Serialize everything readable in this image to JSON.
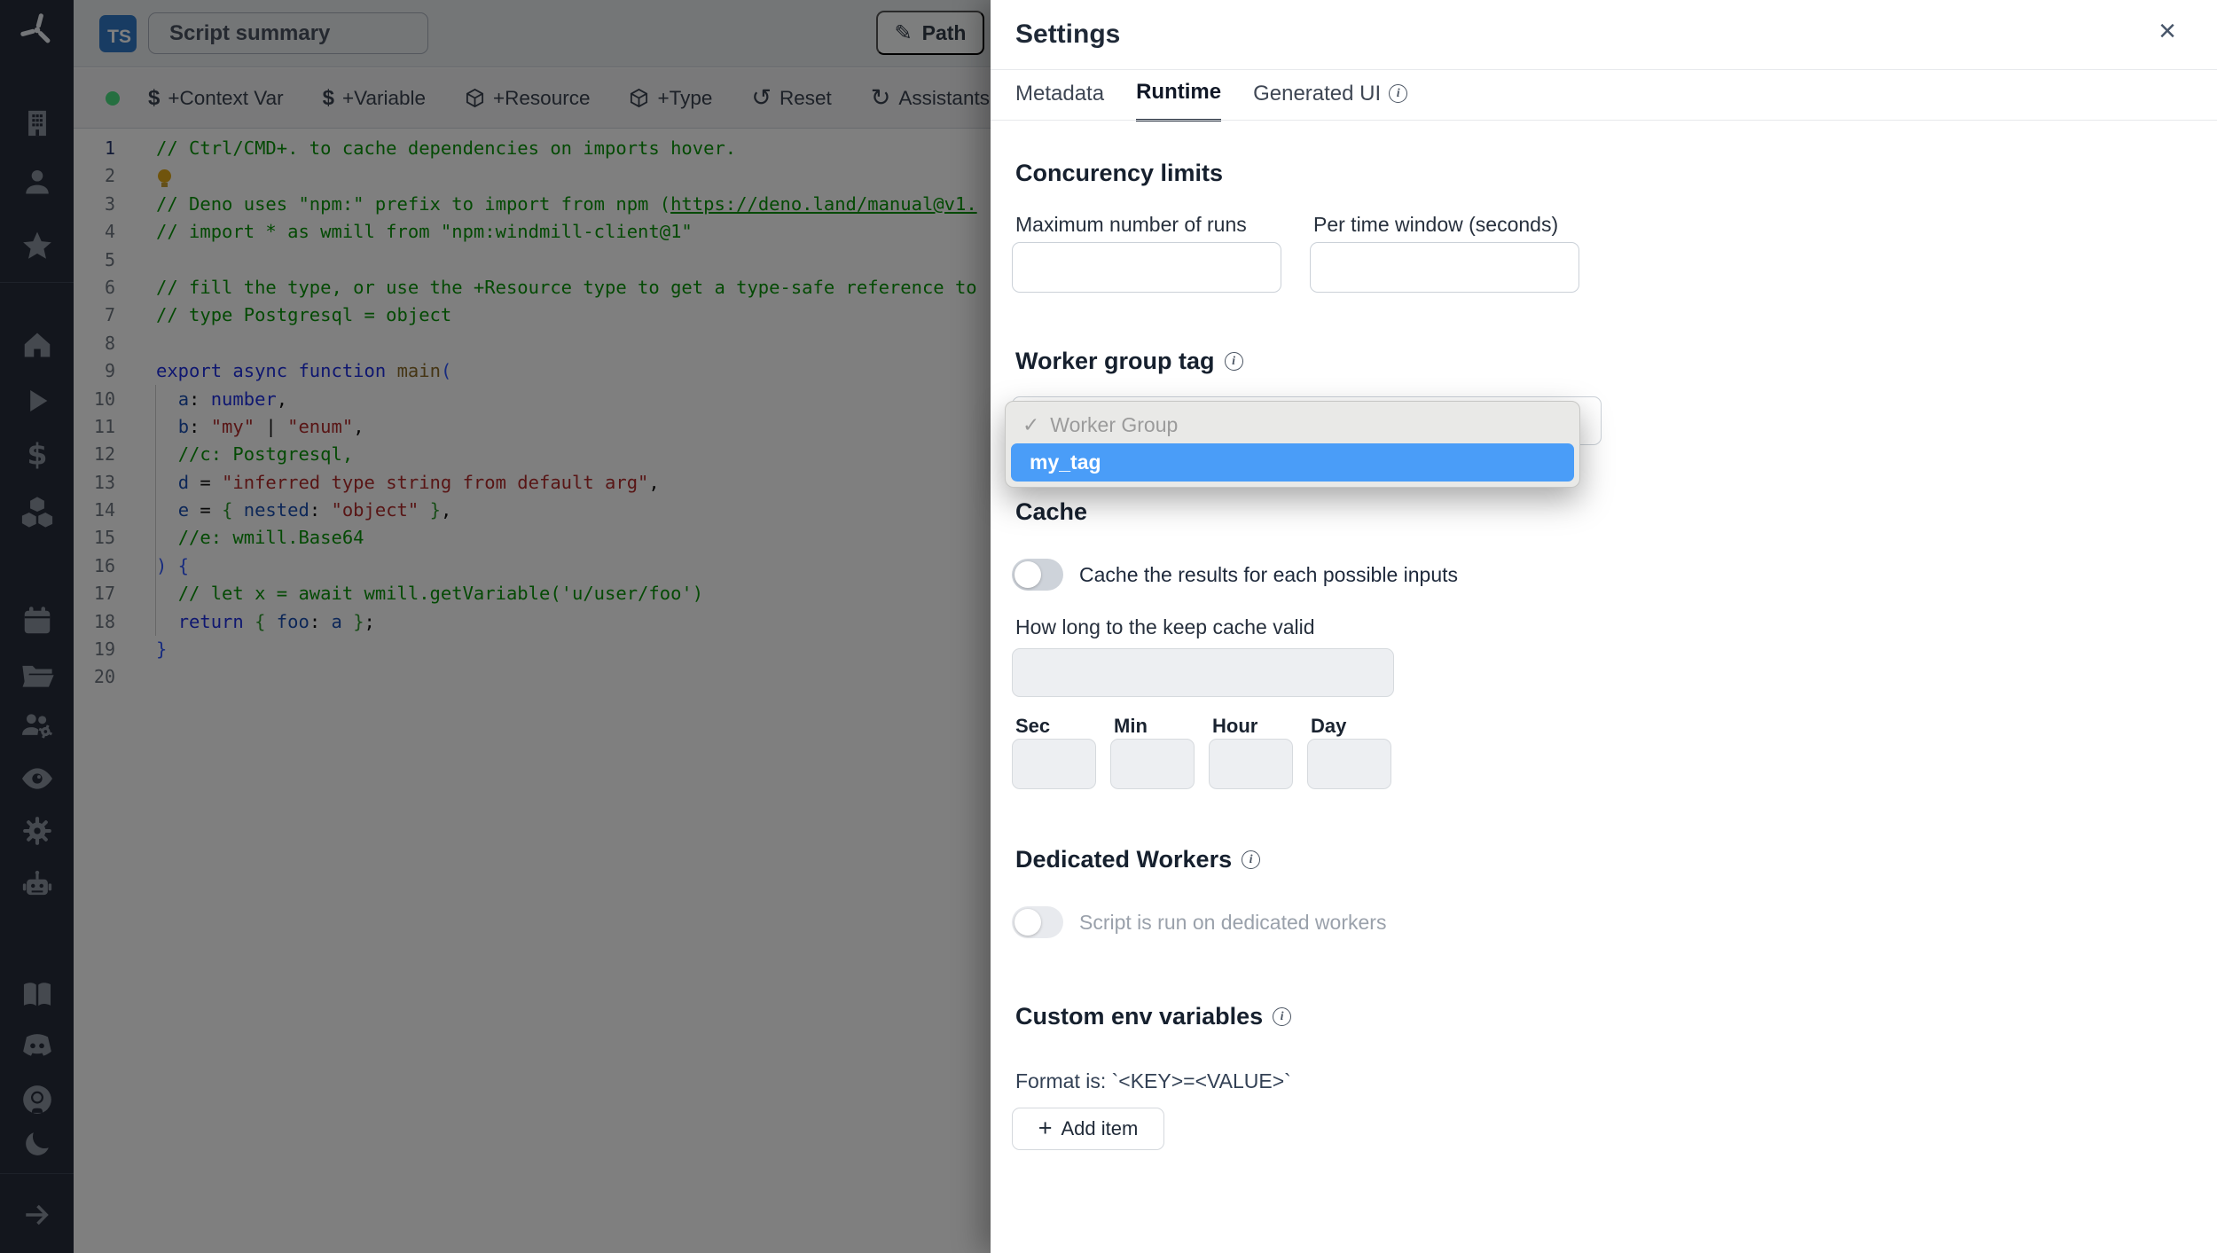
{
  "topbar": {
    "language_badge": "TS",
    "summary_placeholder": "Script summary",
    "path_button": "Path",
    "pencil_icon": "✎"
  },
  "toolbar": {
    "status_dot_color": "#4ade80",
    "items": [
      {
        "icon": "dollar-icon",
        "label": "+Context Var"
      },
      {
        "icon": "dollar-icon",
        "label": "+Variable"
      },
      {
        "icon": "cube-icon",
        "label": "+Resource"
      },
      {
        "icon": "cube-icon",
        "label": "+Type"
      },
      {
        "icon": "undo-icon",
        "label": "Reset"
      },
      {
        "icon": "refresh-icon",
        "label": "Assistants ("
      }
    ],
    "undo_glyph": "↺",
    "refresh_glyph": "↻"
  },
  "sidebar": {
    "icons": [
      "building",
      "person",
      "star",
      "home",
      "play",
      "dollar",
      "cubes",
      "calendar",
      "folder",
      "users-gear",
      "eye",
      "gear",
      "robot",
      "book",
      "discord",
      "github",
      "moon",
      "arrow-right"
    ]
  },
  "editor": {
    "lines": [
      {
        "n": "1",
        "t": [
          [
            "c",
            "// Ctrl/CMD+. to cache dependencies on imports hover."
          ]
        ]
      },
      {
        "n": "2",
        "t": [
          [
            "bulb",
            ""
          ]
        ]
      },
      {
        "n": "3",
        "t": [
          [
            "c",
            "// Deno uses \"npm:\" prefix to import from npm ("
          ],
          [
            "cu",
            "https://deno.land/manual@v1."
          ]
        ]
      },
      {
        "n": "4",
        "t": [
          [
            "c",
            "// import * as wmill from \"npm:windmill-client@1\""
          ]
        ]
      },
      {
        "n": "5",
        "t": []
      },
      {
        "n": "6",
        "t": [
          [
            "c",
            "// fill the type, or use the +Resource type to get a type-safe reference to"
          ]
        ]
      },
      {
        "n": "7",
        "t": [
          [
            "c",
            "// type Postgresql = object"
          ]
        ]
      },
      {
        "n": "8",
        "t": []
      },
      {
        "n": "9",
        "t": [
          [
            "k",
            "export"
          ],
          [
            "d",
            " "
          ],
          [
            "k",
            "async"
          ],
          [
            "d",
            " "
          ],
          [
            "k",
            "function"
          ],
          [
            "d",
            " "
          ],
          [
            "f",
            "main"
          ],
          [
            "b1",
            "("
          ]
        ]
      },
      {
        "n": "10",
        "t": [
          [
            "d",
            "  "
          ],
          [
            "p",
            "a"
          ],
          [
            "d",
            ": "
          ],
          [
            "k",
            "number"
          ],
          [
            "d",
            ","
          ]
        ]
      },
      {
        "n": "11",
        "t": [
          [
            "d",
            "  "
          ],
          [
            "p",
            "b"
          ],
          [
            "d",
            ": "
          ],
          [
            "s",
            "\"my\""
          ],
          [
            "d",
            " | "
          ],
          [
            "s",
            "\"enum\""
          ],
          [
            "d",
            ","
          ]
        ]
      },
      {
        "n": "12",
        "t": [
          [
            "d",
            "  "
          ],
          [
            "c",
            "//c: Postgresql,"
          ]
        ]
      },
      {
        "n": "13",
        "t": [
          [
            "d",
            "  "
          ],
          [
            "p",
            "d"
          ],
          [
            "d",
            " = "
          ],
          [
            "s",
            "\"inferred type string from default arg\""
          ],
          [
            "d",
            ","
          ]
        ]
      },
      {
        "n": "14",
        "t": [
          [
            "d",
            "  "
          ],
          [
            "p",
            "e"
          ],
          [
            "d",
            " = "
          ],
          [
            "b2",
            "{"
          ],
          [
            "d",
            " "
          ],
          [
            "p",
            "nested"
          ],
          [
            "d",
            ": "
          ],
          [
            "s",
            "\"object\""
          ],
          [
            "d",
            " "
          ],
          [
            "b2",
            "}"
          ],
          [
            "d",
            ","
          ]
        ]
      },
      {
        "n": "15",
        "t": [
          [
            "d",
            "  "
          ],
          [
            "c",
            "//e: wmill.Base64"
          ]
        ]
      },
      {
        "n": "16",
        "t": [
          [
            "b1",
            ") {"
          ]
        ]
      },
      {
        "n": "17",
        "t": [
          [
            "d",
            "  "
          ],
          [
            "c",
            "// let x = await wmill.getVariable('u/user/foo')"
          ]
        ]
      },
      {
        "n": "18",
        "t": [
          [
            "d",
            "  "
          ],
          [
            "k",
            "return"
          ],
          [
            "d",
            " "
          ],
          [
            "b2",
            "{"
          ],
          [
            "d",
            " "
          ],
          [
            "p",
            "foo"
          ],
          [
            "d",
            ": "
          ],
          [
            "p",
            "a"
          ],
          [
            "d",
            " "
          ],
          [
            "b2",
            "}"
          ],
          [
            "d",
            ";"
          ]
        ]
      },
      {
        "n": "19",
        "t": [
          [
            "b1",
            "}"
          ]
        ]
      },
      {
        "n": "20",
        "t": []
      }
    ]
  },
  "panel": {
    "title": "Settings",
    "close_glyph": "×",
    "tabs": {
      "metadata": "Metadata",
      "runtime": "Runtime",
      "generated_ui": "Generated UI"
    },
    "concurrency": {
      "heading": "Concurency limits",
      "max_label": "Maximum number of runs",
      "window_label": "Per time window (seconds)"
    },
    "worker_group": {
      "heading": "Worker group tag"
    },
    "cache": {
      "heading": "Cache",
      "toggle_label": "Cache the results for each possible inputs",
      "duration_label": "How long to the keep cache valid",
      "units": [
        "Sec",
        "Min",
        "Hour",
        "Day"
      ]
    },
    "dedicated": {
      "heading": "Dedicated Workers",
      "toggle_label": "Script is run on dedicated workers"
    },
    "custom_env": {
      "heading": "Custom env variables",
      "format_hint": "Format is: `<KEY>=<VALUE>`",
      "add_button": "Add item",
      "plus_glyph": "+"
    }
  },
  "dropdown": {
    "check_glyph": "✓",
    "group_header": "Worker Group",
    "selected_item": "my_tag",
    "highlight_color": "#4a9df8"
  }
}
